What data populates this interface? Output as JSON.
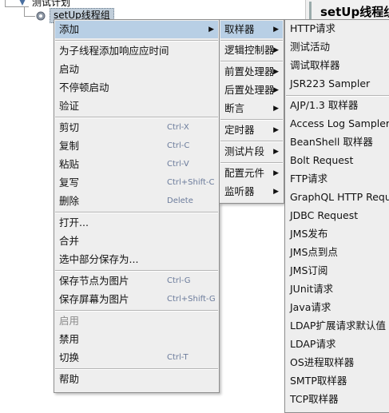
{
  "tree": {
    "root_label": "测试计划",
    "selected_label": "setUp线程组"
  },
  "header": {
    "title": "setUp线程组"
  },
  "context_menu": {
    "items": [
      {
        "label": "添加",
        "submenu": true
      },
      {
        "label": "为子线程添加响应应时间"
      },
      {
        "label": "启动"
      },
      {
        "label": "不停顿启动"
      },
      {
        "label": "验证"
      },
      {
        "label": "剪切",
        "shortcut": "Ctrl-X"
      },
      {
        "label": "复制",
        "shortcut": "Ctrl-C"
      },
      {
        "label": "粘贴",
        "shortcut": "Ctrl-V"
      },
      {
        "label": "复写",
        "shortcut": "Ctrl+Shift-C"
      },
      {
        "label": "删除",
        "shortcut": "Delete"
      },
      {
        "label": "打开..."
      },
      {
        "label": "合并"
      },
      {
        "label": "选中部分保存为..."
      },
      {
        "label": "保存节点为图片",
        "shortcut": "Ctrl-G"
      },
      {
        "label": "保存屏幕为图片",
        "shortcut": "Ctrl+Shift-G"
      },
      {
        "label": "启用",
        "disabled": true
      },
      {
        "label": "禁用"
      },
      {
        "label": "切换",
        "shortcut": "Ctrl-T"
      },
      {
        "label": "帮助"
      }
    ]
  },
  "add_submenu": {
    "items": [
      {
        "label": "取样器"
      },
      {
        "label": "逻辑控制器"
      },
      {
        "label": "前置处理器"
      },
      {
        "label": "后置处理器"
      },
      {
        "label": "断言"
      },
      {
        "label": "定时器"
      },
      {
        "label": "测试片段"
      },
      {
        "label": "配置元件"
      },
      {
        "label": "监听器"
      }
    ]
  },
  "sampler_submenu": {
    "items": [
      {
        "label": "HTTP请求"
      },
      {
        "label": "测试活动"
      },
      {
        "label": "调试取样器"
      },
      {
        "label": "JSR223 Sampler"
      },
      {
        "label": "AJP/1.3 取样器"
      },
      {
        "label": "Access Log Sampler"
      },
      {
        "label": "BeanShell 取样器"
      },
      {
        "label": "Bolt Request"
      },
      {
        "label": "FTP请求"
      },
      {
        "label": "GraphQL HTTP Request"
      },
      {
        "label": "JDBC Request"
      },
      {
        "label": "JMS发布"
      },
      {
        "label": "JMS点到点"
      },
      {
        "label": "JMS订阅"
      },
      {
        "label": "JUnit请求"
      },
      {
        "label": "Java请求"
      },
      {
        "label": "LDAP扩展请求默认值"
      },
      {
        "label": "LDAP请求"
      },
      {
        "label": "OS进程取样器"
      },
      {
        "label": "SMTP取样器"
      },
      {
        "label": "TCP取样器"
      }
    ]
  }
}
